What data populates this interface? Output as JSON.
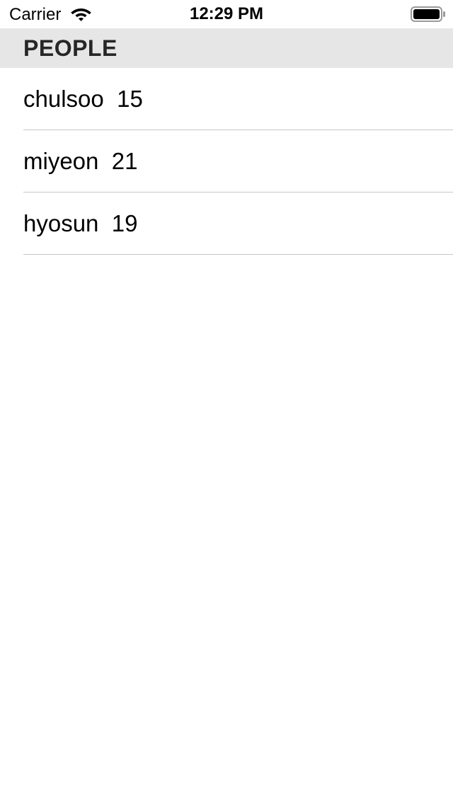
{
  "status_bar": {
    "carrier": "Carrier",
    "time": "12:29 PM",
    "wifi_icon": "wifi-icon",
    "battery_icon": "battery-icon"
  },
  "section": {
    "title": "PEOPLE"
  },
  "people": [
    {
      "name": "chulsoo",
      "age": "15"
    },
    {
      "name": "miyeon",
      "age": "21"
    },
    {
      "name": "hyosun",
      "age": "19"
    }
  ],
  "colors": {
    "header_background": "#e6e6e6",
    "separator": "#c8c7cc"
  }
}
